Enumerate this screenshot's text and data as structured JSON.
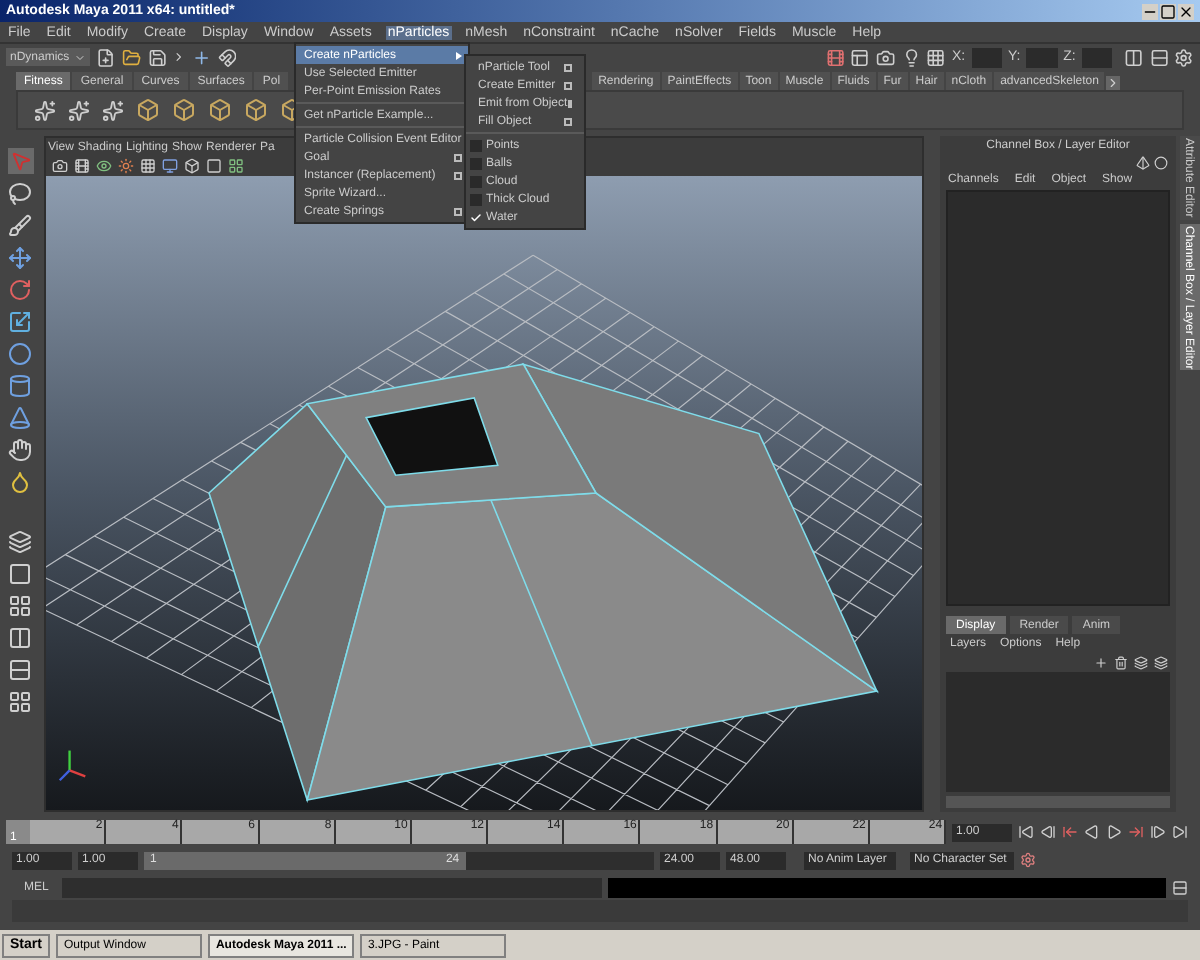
{
  "window": {
    "title": "Autodesk Maya 2011 x64: untitled*"
  },
  "menu_bar": [
    {
      "label": "File",
      "selected": false
    },
    {
      "label": "Edit",
      "selected": false
    },
    {
      "label": "Modify",
      "selected": false
    },
    {
      "label": "Create",
      "selected": false
    },
    {
      "label": "Display",
      "selected": false
    },
    {
      "label": "Window",
      "selected": false
    },
    {
      "label": "Assets",
      "selected": false
    },
    {
      "label": "nParticles",
      "selected": true
    },
    {
      "label": "nMesh",
      "selected": false
    },
    {
      "label": "nConstraint",
      "selected": false
    },
    {
      "label": "nCache",
      "selected": false
    },
    {
      "label": "nSolver",
      "selected": false
    },
    {
      "label": "Fields",
      "selected": false
    },
    {
      "label": "Muscle",
      "selected": false
    },
    {
      "label": "Help",
      "selected": false
    }
  ],
  "status_line": {
    "menu_set": "nDynamics",
    "x_label": "X:",
    "y_label": "Y:",
    "z_label": "Z:"
  },
  "shelf": {
    "tabs_left": [
      {
        "label": "Fitness",
        "selected": true
      },
      {
        "label": "General",
        "selected": false
      },
      {
        "label": "Curves",
        "selected": false
      },
      {
        "label": "Surfaces",
        "selected": false
      },
      {
        "label": "Pol",
        "selected": false
      }
    ],
    "tabs_right": [
      {
        "label": "Rendering",
        "selected": false
      },
      {
        "label": "PaintEffects",
        "selected": false
      },
      {
        "label": "Toon",
        "selected": false
      },
      {
        "label": "Muscle",
        "selected": false
      },
      {
        "label": "Fluids",
        "selected": false
      },
      {
        "label": "Fur",
        "selected": false
      },
      {
        "label": "Hair",
        "selected": false
      },
      {
        "label": "nCloth",
        "selected": false
      },
      {
        "label": "advancedSkeleton",
        "selected": false
      }
    ]
  },
  "nparticles_menu": {
    "items": [
      {
        "kind": "item",
        "label": "Create nParticles",
        "selected": true,
        "submenu": true,
        "option_box": false
      },
      {
        "kind": "item",
        "label": "Use Selected Emitter",
        "selected": false,
        "submenu": false,
        "option_box": false
      },
      {
        "kind": "item",
        "label": "Per-Point Emission Rates",
        "selected": false,
        "submenu": false,
        "option_box": false
      },
      {
        "kind": "separator"
      },
      {
        "kind": "item",
        "label": "Get nParticle Example...",
        "selected": false,
        "submenu": false,
        "option_box": false
      },
      {
        "kind": "separator"
      },
      {
        "kind": "item",
        "label": "Particle Collision Event Editor",
        "selected": false,
        "submenu": false,
        "option_box": false
      },
      {
        "kind": "item",
        "label": "Goal",
        "selected": false,
        "submenu": false,
        "option_box": true
      },
      {
        "kind": "item",
        "label": "Instancer (Replacement)",
        "selected": false,
        "submenu": false,
        "option_box": true
      },
      {
        "kind": "item",
        "label": "Sprite Wizard...",
        "selected": false,
        "submenu": false,
        "option_box": false
      },
      {
        "kind": "item",
        "label": "Create Springs",
        "selected": false,
        "submenu": false,
        "option_box": true
      }
    ]
  },
  "create_nparticles_submenu": {
    "items": [
      {
        "kind": "tool",
        "label": "nParticle Tool"
      },
      {
        "kind": "tool",
        "label": "Create Emitter"
      },
      {
        "kind": "tool",
        "label": "Emit from Object"
      },
      {
        "kind": "tool",
        "label": "Fill Object"
      },
      {
        "kind": "separator"
      },
      {
        "kind": "style",
        "label": "Points",
        "checked": false
      },
      {
        "kind": "style",
        "label": "Balls",
        "checked": false
      },
      {
        "kind": "style",
        "label": "Cloud",
        "checked": false
      },
      {
        "kind": "style",
        "label": "Thick Cloud",
        "checked": false
      },
      {
        "kind": "style",
        "label": "Water",
        "checked": true
      }
    ]
  },
  "viewport": {
    "menu": [
      "View",
      "Shading",
      "Lighting",
      "Show",
      "Renderer",
      "Pa"
    ]
  },
  "channel_box": {
    "title": "Channel Box / Layer Editor",
    "menu": [
      "Channels",
      "Edit",
      "Object",
      "Show"
    ]
  },
  "layer_editor": {
    "tabs": [
      {
        "label": "Display",
        "selected": true
      },
      {
        "label": "Render",
        "selected": false
      },
      {
        "label": "Anim",
        "selected": false
      }
    ],
    "menu": [
      "Layers",
      "Options",
      "Help"
    ]
  },
  "side_tabs": [
    {
      "label": "Attribute Editor",
      "selected": false
    },
    {
      "label": "Channel Box / Layer Editor",
      "selected": true
    }
  ],
  "time_slider": {
    "level": 0,
    "current_frame": "1",
    "ticks": [
      "2",
      "4",
      "6",
      "8",
      "10",
      "12",
      "14",
      "16",
      "18",
      "20",
      "22",
      "24"
    ],
    "current_time": "1.00"
  },
  "range_slider": {
    "level": 0.63,
    "start_time": "1.00",
    "playback_start": "1.00",
    "range_start": "1",
    "range_end": "24",
    "playback_end": "24.00",
    "end_time": "48.00",
    "anim_layer": "No Anim Layer",
    "character_set": "No Character Set"
  },
  "command_line": {
    "label": "MEL"
  },
  "taskbar": {
    "start": "Start",
    "buttons": [
      {
        "label": "Output Window",
        "selected": false
      },
      {
        "label": "Autodesk Maya 2011 ...",
        "selected": true
      },
      {
        "label": "3.JPG - Paint",
        "selected": false
      }
    ]
  }
}
